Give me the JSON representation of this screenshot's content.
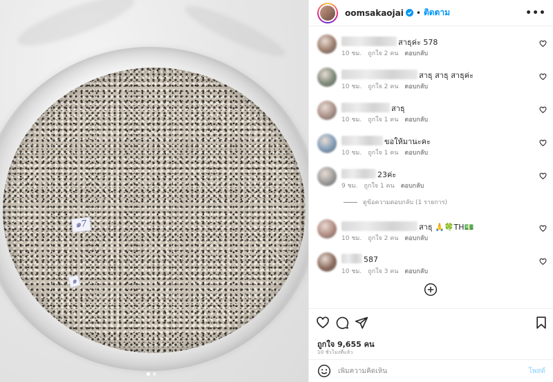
{
  "header": {
    "username": "oomsakaojai",
    "separator": "•",
    "follow_label": "ติดตาม",
    "more_label": "•••"
  },
  "photo": {
    "tag1": "๑7",
    "tag2": "๑"
  },
  "comments": [
    {
      "text": "สาธุค่ะ 578",
      "time": "10 ชม.",
      "likes": "ถูกใจ 2 คน",
      "reply": "ตอบกลับ",
      "avatar_color": "#9b7c6b"
    },
    {
      "text": "สาธุ สาธุ สาธุค่ะ",
      "time": "10 ชม.",
      "likes": "ถูกใจ 2 คน",
      "reply": "ตอบกลับ",
      "avatar_color": "#7d8a78"
    },
    {
      "text": "สาธุ",
      "time": "10 ชม.",
      "likes": "ถูกใจ 1 คน",
      "reply": "ตอบกลับ",
      "avatar_color": "#a88f85"
    },
    {
      "text": "ขอให้มานะคะ",
      "time": "10 ชม.",
      "likes": "ถูกใจ 1 คน",
      "reply": "ตอบกลับ",
      "avatar_color": "#7e9bb7"
    },
    {
      "text": "23ค่ะ",
      "time": "9 ชม.",
      "likes": "ถูกใจ 1 คน",
      "reply": "ตอบกลับ",
      "avatar_color": "#9a9a9a"
    },
    {
      "text": "สาธุ 🙏🍀TH💵",
      "time": "10 ชม.",
      "likes": "ถูกใจ 2 คน",
      "reply": "ตอบกลับ",
      "avatar_color": "#b08a80"
    },
    {
      "text": "587",
      "time": "10 ชม.",
      "likes": "ถูกใจ 3 คน",
      "reply": "ตอบกลับ",
      "avatar_color": "#8a6a5c"
    }
  ],
  "view_replies": "ดูข้อความตอบกลับ (1 รายการ)",
  "post": {
    "likes": "ถูกใจ 9,655 คน",
    "time": "10 ชั่วโมงที่แล้ว"
  },
  "add_comment": {
    "placeholder": "เพิ่มความคิดเห็น",
    "post_label": "โพสต์"
  },
  "colors": {
    "accent": "#0095f6",
    "post_disabled": "#b2dffc",
    "muted": "#8e8e8e",
    "text": "#262626"
  }
}
